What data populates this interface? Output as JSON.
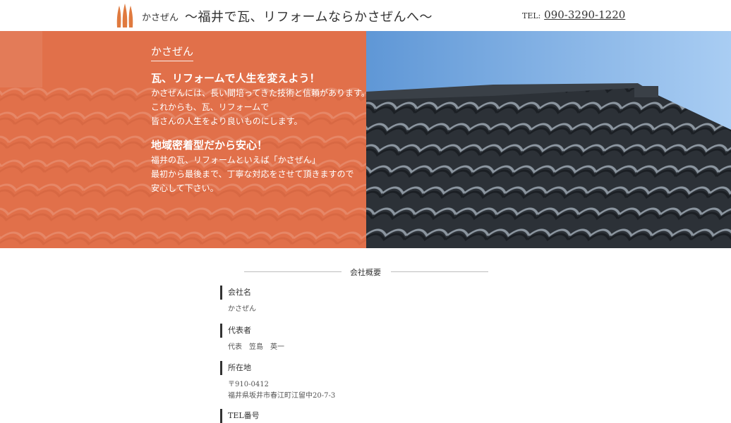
{
  "header": {
    "brand": "かさぜん",
    "tagline": "〜福井で瓦、リフォームならかさぜんへ〜",
    "tel_label": "TEL:",
    "tel_number": "090-3290-1220"
  },
  "hero": {
    "brand": "かさぜん",
    "block1_heading": "瓦、リフォームで人生を変えよう！",
    "block1_lines": [
      "かさぜんには、長い間培ってきた技術と信頼があります。",
      "これからも、瓦、リフォームで",
      "皆さんの人生をより良いものにします。"
    ],
    "block2_heading": "地域密着型だから安心！",
    "block2_lines": [
      "福井の瓦、リフォームといえば「かさぜん」",
      "最初から最後まで、丁寧な対応をさせて頂きますので",
      "安心して下さい。"
    ]
  },
  "company": {
    "section_title": "会社概要",
    "items": [
      {
        "label": "会社名",
        "value_lines": [
          "かさぜん"
        ]
      },
      {
        "label": "代表者",
        "value_lines": [
          "代表　笠島　英一"
        ]
      },
      {
        "label": "所在地",
        "value_lines": [
          "〒910-0412",
          "福井県坂井市春江町江留中20-7-3"
        ]
      },
      {
        "label": "TEL番号",
        "value_lines": []
      }
    ]
  },
  "colors": {
    "accent": "#e1704a",
    "logo": "#e07a3f",
    "sky": "#7fb3e6",
    "tile": "#2f343a"
  }
}
